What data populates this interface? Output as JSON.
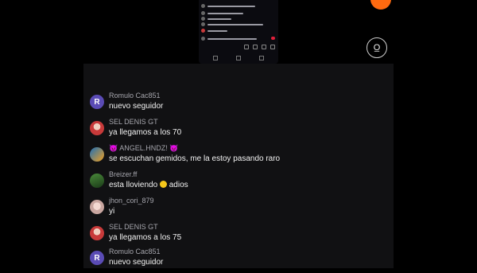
{
  "camera_button": {
    "label": "O̲"
  },
  "chat": {
    "messages": [
      {
        "username": "Romulo Cac851",
        "text": "nuevo seguidor",
        "avatar": {
          "letter": "R",
          "color": "#5a4bb5"
        }
      },
      {
        "username": "SEL DENIS GT",
        "text": "ya llegamos a los 70",
        "avatar": {
          "letter": "",
          "color": "#c83a3a"
        }
      },
      {
        "username": "ANGEL.HNDZ!",
        "text": "se escuchan gemidos, me la estoy pasando raro",
        "avatar": {
          "letter": "",
          "color": "#1d6fb8"
        },
        "emoji_decor": "devil"
      },
      {
        "username": "Breizer.ff",
        "text": "esta lloviendo",
        "text_after": "adios",
        "avatar": {
          "letter": "",
          "color": "#2f6a2a"
        },
        "emoji": "sad-face"
      },
      {
        "username": "jhon_cori_879",
        "text": "yi",
        "avatar": {
          "letter": "",
          "color": "#d8b4b0"
        }
      },
      {
        "username": "SEL DENIS GT",
        "text": "ya llegamos a los 75",
        "avatar": {
          "letter": "",
          "color": "#c83a3a"
        }
      },
      {
        "username": "Romulo Cac851",
        "text": "nuevo seguidor",
        "avatar": {
          "letter": "R",
          "color": "#5a4bb5"
        }
      }
    ]
  },
  "colors": {
    "panel_bg": "#111113",
    "username": "#a6a6ad",
    "accent_orange": "#ff6a10"
  }
}
